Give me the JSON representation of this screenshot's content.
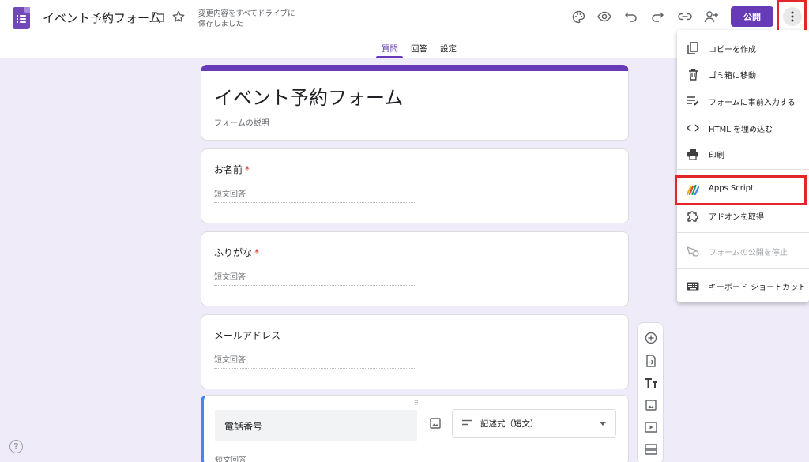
{
  "header": {
    "title": "イベント予約フォーム",
    "save_status": "変更内容をすべてドライブに保存しました",
    "publish_label": "公開"
  },
  "tabs": [
    {
      "label": "質問",
      "active": true
    },
    {
      "label": "回答",
      "active": false
    },
    {
      "label": "設定",
      "active": false
    }
  ],
  "form": {
    "title": "イベント予約フォーム",
    "description": "フォームの説明",
    "questions": [
      {
        "label": "お名前",
        "required": true,
        "answer_placeholder": "短文回答"
      },
      {
        "label": "ふりがな",
        "required": true,
        "answer_placeholder": "短文回答"
      },
      {
        "label": "メールアドレス",
        "required": false,
        "answer_placeholder": "短文回答"
      }
    ],
    "active_question": {
      "title": "電話番号",
      "type_label": "記述式（短文）",
      "answer_placeholder": "短文回答"
    }
  },
  "menu": {
    "items": [
      {
        "label": "コピーを作成",
        "icon": "copy-icon"
      },
      {
        "label": "ゴミ箱に移動",
        "icon": "trash-icon"
      },
      {
        "label": "フォームに事前入力する",
        "icon": "prefill-icon"
      },
      {
        "label": "HTML を埋め込む",
        "icon": "code-icon"
      },
      {
        "label": "印刷",
        "icon": "print-icon"
      },
      {
        "label": "Apps Script",
        "icon": "apps-script-icon"
      },
      {
        "label": "アドオンを取得",
        "icon": "puzzle-icon"
      },
      {
        "label": "フォームの公開を停止",
        "icon": "stop-publish-icon",
        "disabled": true
      },
      {
        "label": "キーボード ショートカット",
        "icon": "keyboard-icon"
      }
    ]
  },
  "colors": {
    "accent": "#673ab7",
    "background": "#efebf8",
    "highlight": "#e3262a",
    "active_question_border": "#4285f4",
    "required": "#d93025"
  },
  "help": "?"
}
